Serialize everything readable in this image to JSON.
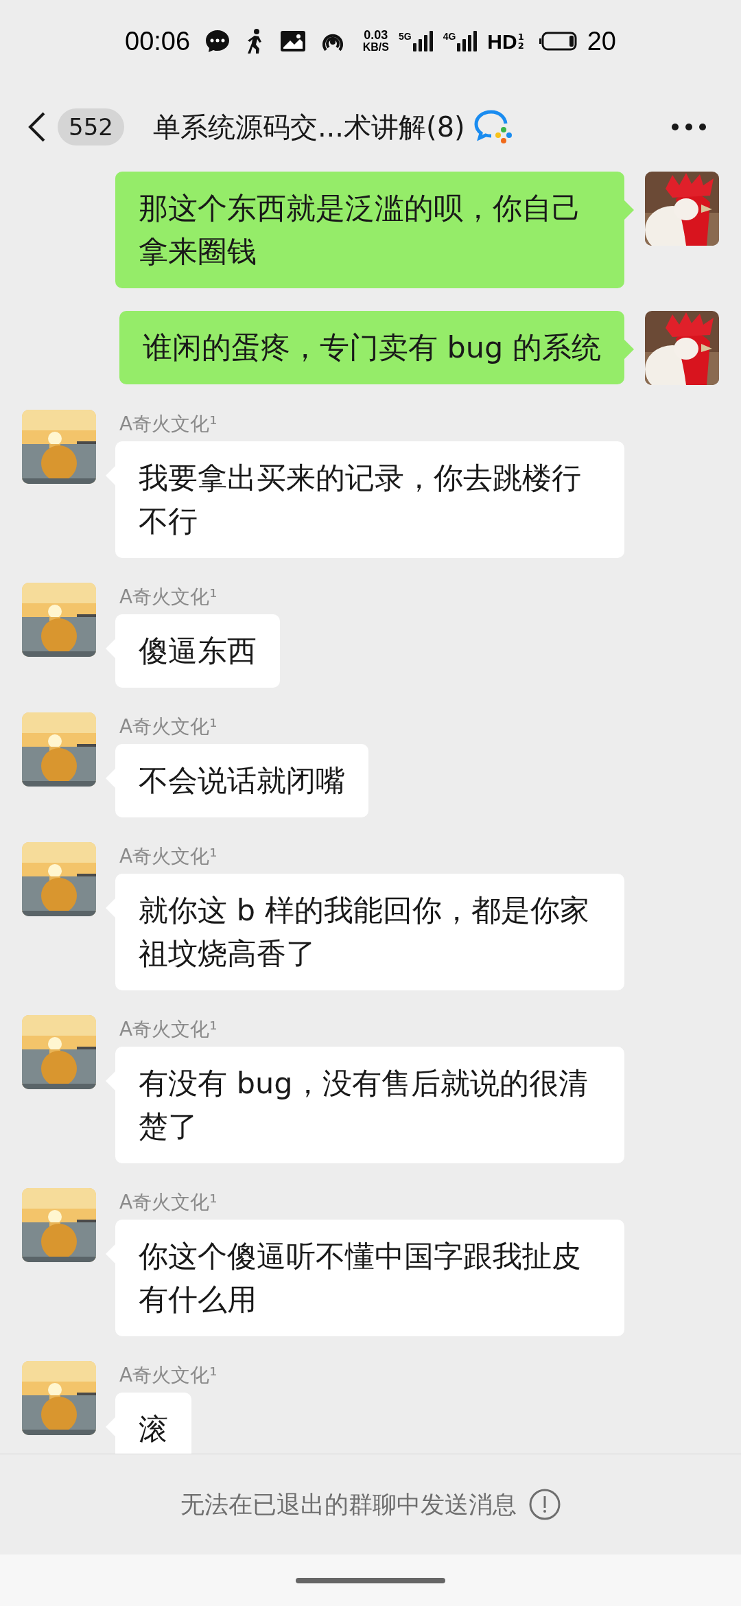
{
  "status_bar": {
    "time": "00:06",
    "net_speed_value": "0.03",
    "net_speed_unit": "KB/S",
    "sim1_type": "5G",
    "sim2_type": "4G",
    "hd": "HD",
    "hd_sim1": "1",
    "hd_sim2": "2",
    "battery": "20"
  },
  "header": {
    "unread_count": "552",
    "title": "单系统源码交...术讲解(8)"
  },
  "messages": [
    {
      "kind": "outgoing",
      "text": "那这个东西就是泛滥的呗，你自己拿来圈钱"
    },
    {
      "kind": "outgoing",
      "text": "谁闲的蛋疼，专门卖有 bug 的系统"
    },
    {
      "kind": "incoming",
      "sender": "A奇火文化¹",
      "text": "我要拿出买来的记录，你去跳楼行不行"
    },
    {
      "kind": "incoming",
      "sender": "A奇火文化¹",
      "text": "傻逼东西"
    },
    {
      "kind": "incoming",
      "sender": "A奇火文化¹",
      "text": "不会说话就闭嘴"
    },
    {
      "kind": "incoming",
      "sender": "A奇火文化¹",
      "text": "就你这 b 样的我能回你，都是你家祖坟烧高香了"
    },
    {
      "kind": "incoming",
      "sender": "A奇火文化¹",
      "text": "有没有 bug，没有售后就说的很清楚了"
    },
    {
      "kind": "incoming",
      "sender": "A奇火文化¹",
      "text": "你这个傻逼听不懂中国字跟我扯皮有什么用"
    },
    {
      "kind": "incoming",
      "sender": "A奇火文化¹",
      "text": "滚"
    }
  ],
  "footer": {
    "notice": "无法在已退出的群聊中发送消息"
  }
}
